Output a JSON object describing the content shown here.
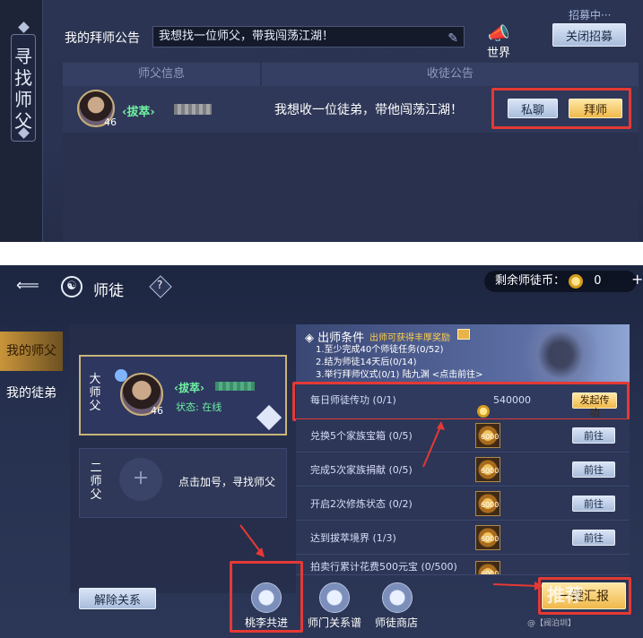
{
  "panel1": {
    "side_title": "寻找师父",
    "notice_label": "我的拜师公告",
    "notice_value": "我想找一位师父，带我闯荡江湖！",
    "world_label": "世界",
    "recruit_status": "招募中···",
    "close_recruit_label": "关闭招募",
    "columns": [
      "师父信息",
      "收徒公告"
    ],
    "row": {
      "sect": "拔萃",
      "level": "46",
      "announcement": "我想收一位徒弟，带他闯荡江湖！",
      "private_chat_label": "私聊",
      "apprentice_label": "拜师"
    }
  },
  "panel2": {
    "title": "师徒",
    "coins_label": "剩余师徒币：",
    "coins_value": "0",
    "tabs": [
      "我的师父",
      "我的徒弟"
    ],
    "master_card": {
      "slot_label": "大师父",
      "sect": "拔萃",
      "level": "46",
      "status": "状态: 在线"
    },
    "second_card": {
      "slot_label": "二师父",
      "add_hint": "点击加号，寻找师父"
    },
    "graduation": {
      "title": "出师条件",
      "reward_hint": "出师可获得丰厚奖励",
      "conditions": [
        "1.至少完成40个师徒任务(0/52)",
        "2.结为师徒14天后(0/14)",
        "3.举行拜师仪式(0/1)  陆九渊 <点击前往>"
      ]
    },
    "tasks": [
      {
        "name": "每日师徒传功 (0/1)",
        "reward": "540000",
        "action": "发起传功"
      },
      {
        "name": "兑换5个家族宝箱 (0/5)",
        "reward": "6000",
        "action": "前往"
      },
      {
        "name": "完成5次家族捐献 (0/5)",
        "reward": "6000",
        "action": "前往"
      },
      {
        "name": "开启2次修炼状态 (0/2)",
        "reward": "6000",
        "action": "前往"
      },
      {
        "name": "达到拔萃境界 (1/3)",
        "reward": "6000",
        "action": "前往"
      },
      {
        "name": "拍卖行累计花费500元宝 (0/500)",
        "reward": "6000",
        "action": ""
      }
    ],
    "bottom": {
      "dissolve_label": "解除关系",
      "buttons": [
        "桃李共进",
        "师门关系谱",
        "师徒商店"
      ],
      "report_label": "一键汇报",
      "watermark": "@【阀泊圳】 ",
      "watermark2": "推荐"
    }
  },
  "colors": {
    "highlight_red": "#e53935",
    "accent_gold": "#f0b94b",
    "sect_green": "#6ef2a2"
  }
}
